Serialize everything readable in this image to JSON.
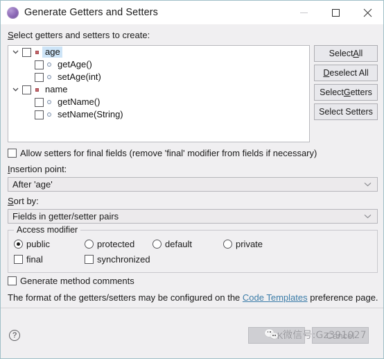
{
  "window": {
    "title": "Generate Getters and Setters",
    "icon": "eclipse-dialog-icon",
    "controls": {
      "minimize": "minimize-icon",
      "maximize": "maximize-icon",
      "close": "close-icon"
    }
  },
  "main": {
    "tree_label": "Select getters and setters to create:",
    "tree": [
      {
        "label": "age",
        "type": "field",
        "level": 0,
        "expanded": true,
        "checked": false,
        "selected": true
      },
      {
        "label": "getAge()",
        "type": "method",
        "level": 1,
        "expanded": null,
        "checked": false,
        "selected": false
      },
      {
        "label": "setAge(int)",
        "type": "method",
        "level": 1,
        "expanded": null,
        "checked": false,
        "selected": false
      },
      {
        "label": "name",
        "type": "field",
        "level": 0,
        "expanded": true,
        "checked": false,
        "selected": false
      },
      {
        "label": "getName()",
        "type": "method",
        "level": 1,
        "expanded": null,
        "checked": false,
        "selected": false
      },
      {
        "label": "setName(String)",
        "type": "method",
        "level": 1,
        "expanded": null,
        "checked": false,
        "selected": false
      }
    ],
    "side_buttons": [
      {
        "label": "Select All",
        "mnemonic": "A"
      },
      {
        "label": "Deselect All",
        "mnemonic": "D"
      },
      {
        "label": "Select Getters",
        "mnemonic": "G"
      },
      {
        "label": "Select Setters",
        "mnemonic": ""
      }
    ],
    "allow_final": {
      "label": "Allow setters for final fields (remove 'final' modifier from fields if necessary)",
      "checked": false
    },
    "insertion_point": {
      "label": "Insertion point:",
      "value": "After 'age'"
    },
    "sort_by": {
      "label": "Sort by:",
      "value": "Fields in getter/setter pairs"
    },
    "access_modifier": {
      "title": "Access modifier",
      "radios": [
        {
          "label": "public",
          "checked": true
        },
        {
          "label": "protected",
          "checked": false
        },
        {
          "label": "default",
          "checked": false
        },
        {
          "label": "private",
          "checked": false
        }
      ],
      "checkboxes": [
        {
          "label": "final",
          "checked": false
        },
        {
          "label": "synchronized",
          "checked": false
        }
      ]
    },
    "generate_comments": {
      "label": "Generate method comments",
      "checked": false
    },
    "footnote": {
      "prefix": "The format of the getters/setters may be configured on the ",
      "link": "Code Templates",
      "suffix": " preference page."
    }
  },
  "footer": {
    "help": "?",
    "ok": "OK",
    "cancel": "Cancel"
  },
  "watermark": {
    "text": "微信号:Gz391027",
    "logo": "wechat-logo"
  },
  "colors": {
    "dialog_bg": "#f0eff1",
    "dialog_border": "#9fbfc7",
    "titlebar_bg": "#ffffff",
    "list_bg": "#ffffff",
    "selection": "#cde4f7",
    "button_bg": "#e8e8ec",
    "link": "#3b7ca8",
    "disabled_text": "#9a9a9f"
  }
}
